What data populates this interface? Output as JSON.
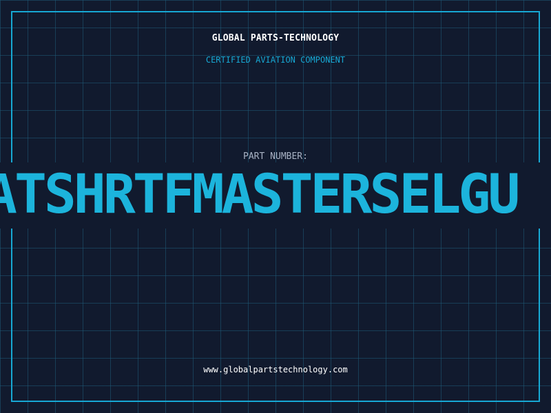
{
  "header": {
    "brand": "GLOBAL PARTS-TECHNOLOGY",
    "tagline": "CERTIFIED AVIATION COMPONENT"
  },
  "part": {
    "label": "PART NUMBER:",
    "value": "ATSHRTFMASTERSELGU"
  },
  "footer": {
    "website": "www.globalpartstechnology.com"
  },
  "colors": {
    "background": "#111a2e",
    "grid": "#1e5a78",
    "accent": "#17a8d4",
    "part_number": "#1cb4dc",
    "label": "#a8b2c4",
    "text": "#ffffff"
  }
}
